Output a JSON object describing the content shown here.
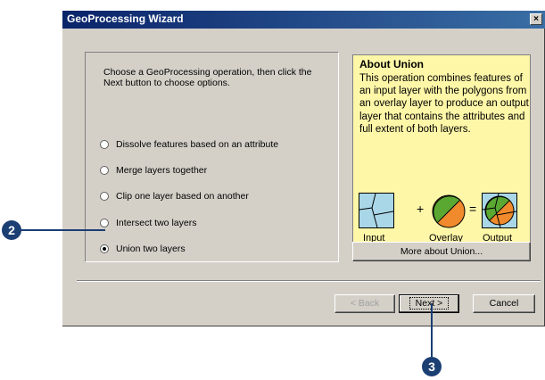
{
  "window": {
    "title": "GeoProcessing Wizard",
    "close_label": "×"
  },
  "intro": "Choose a GeoProcessing operation, then click the Next button to choose options.",
  "options": [
    {
      "label": "Dissolve features based on an attribute",
      "checked": false
    },
    {
      "label": "Merge layers together",
      "checked": false
    },
    {
      "label": "Clip one layer based on another",
      "checked": false
    },
    {
      "label": "Intersect two layers",
      "checked": false
    },
    {
      "label": "Union two layers",
      "checked": true
    }
  ],
  "about": {
    "title": "About Union",
    "description": "This operation combines features of an input layer with the polygons from an overlay layer to produce an output layer that contains the attributes and full extent of both layers.",
    "plus": "+",
    "equals": "=",
    "input_label": "Input",
    "overlay_label": "Overlay",
    "output_label": "Output"
  },
  "buttons": {
    "more": "More about Union...",
    "back": "< Back",
    "next": "Next >",
    "cancel": "Cancel"
  },
  "callouts": {
    "step2": "2",
    "step3": "3"
  },
  "colors": {
    "title_bar": "#0a246a",
    "about_bg": "#fff7a8",
    "map_blue": "#a9d7e8",
    "overlay_green": "#5aa832",
    "overlay_orange": "#f08a2c",
    "callout": "#1b3e73"
  }
}
